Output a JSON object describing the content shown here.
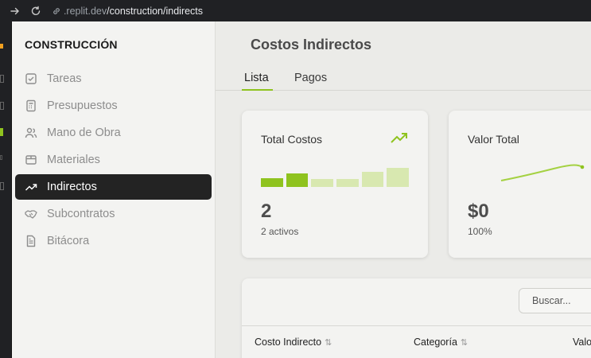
{
  "browser": {
    "url_prefix": ".replit.dev",
    "url_path": "/construction/indirects"
  },
  "sidebar": {
    "brand": "CONSTRUCCIÓN",
    "items": [
      {
        "label": "Tareas",
        "icon": "checkbox-icon"
      },
      {
        "label": "Presupuestos",
        "icon": "calculator-icon"
      },
      {
        "label": "Mano de Obra",
        "icon": "users-icon"
      },
      {
        "label": "Materiales",
        "icon": "box-icon"
      },
      {
        "label": "Indirectos",
        "icon": "trending-up-icon",
        "active": true
      },
      {
        "label": "Subcontratos",
        "icon": "handshake-icon"
      },
      {
        "label": "Bitácora",
        "icon": "document-icon"
      }
    ]
  },
  "main": {
    "title": "Costos Indirectos",
    "tabs": [
      "Lista",
      "Pagos"
    ],
    "active_tab": "Lista"
  },
  "cards": {
    "total": {
      "title": "Total Costos",
      "value": "2",
      "sub": "2 activos",
      "bar_levels": [
        0.42,
        0.65,
        0.38,
        0.38,
        0.73,
        0.92
      ]
    },
    "valor": {
      "title": "Valor Total",
      "value": "$0",
      "sub": "100%"
    }
  },
  "table": {
    "search_placeholder": "Buscar...",
    "columns": [
      "Costo Indirecto",
      "Categoría",
      "Valo"
    ]
  },
  "colors": {
    "accent": "#8fc31f",
    "accent_light": "#d8e8b0",
    "sidebar_active": "#232323"
  }
}
